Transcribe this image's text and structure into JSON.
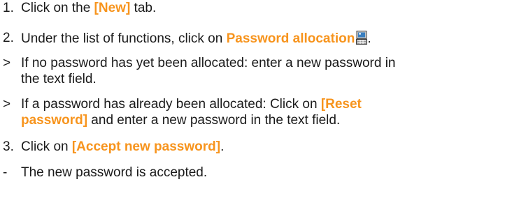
{
  "steps": [
    {
      "marker": "1.",
      "before": "Click on the ",
      "highlight": "[New]",
      "after": " tab."
    },
    {
      "marker": "2.",
      "before": "Under the list of functions, click on ",
      "highlight": "Password allocation",
      "icon": "computer-terminal-icon",
      "after": "."
    },
    {
      "marker": ">",
      "line1": "If no password has yet been allocated: enter a new password in",
      "line2": "the text field."
    },
    {
      "marker": ">",
      "line1_before": "If a password has already been allocated: Click on ",
      "line1_highlight": "[Reset",
      "line2_highlight": "password]",
      "line2_after": " and enter a new password in the text field."
    },
    {
      "marker": "3.",
      "before": "Click on ",
      "highlight": "[Accept new password]",
      "after": "."
    },
    {
      "marker": "-",
      "text": "The new password is accepted."
    }
  ],
  "colors": {
    "highlight": "#f7941d",
    "text": "#1a1a1a"
  }
}
